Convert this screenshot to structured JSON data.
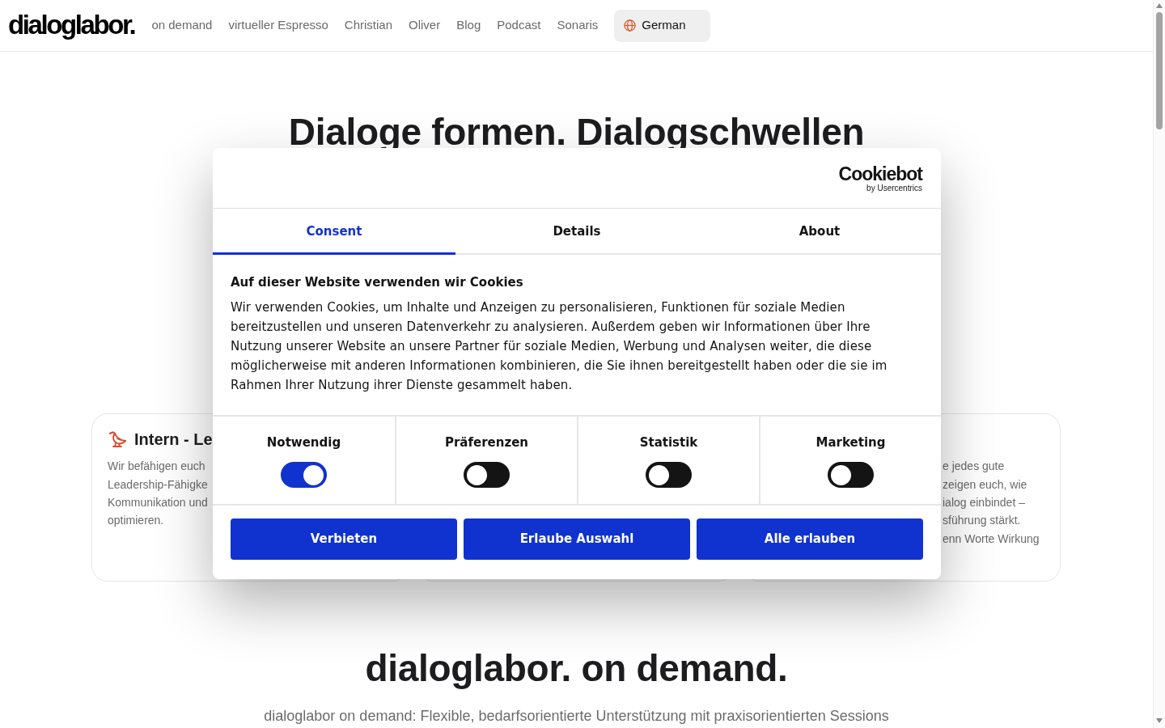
{
  "header": {
    "logo": "dialoglabor.",
    "nav": [
      "on demand",
      "virtueller Espresso",
      "Christian",
      "Oliver",
      "Blog",
      "Podcast",
      "Sonaris"
    ],
    "language": "German"
  },
  "hero": {
    "title": "Dialoge formen. Dialogschwellen"
  },
  "cards": {
    "left": {
      "title": "Intern - Le",
      "body_lines": [
        "Wir befähigen euch",
        "Leadership-Fähigke",
        "Kommunikation und",
        "optimieren."
      ]
    },
    "right": {
      "body_lines": [
        "e jedes gute",
        "zeigen euch, wie",
        "ialog einbindet –",
        "sführung stärkt.",
        "enn Worte Wirkung"
      ]
    }
  },
  "on_demand": {
    "title": "dialoglabor. on demand.",
    "intro": "dialoglabor on demand: Flexible, bedarfsorientierte Unterstützung mit praxisorientierten Sessions"
  },
  "cookie_dialog": {
    "brand": "Cookiebot",
    "brand_tagline": "by Usercentrics",
    "tabs": [
      {
        "label": "Consent",
        "selected": true
      },
      {
        "label": "Details",
        "selected": false
      },
      {
        "label": "About",
        "selected": false
      }
    ],
    "heading": "Auf dieser Website verwenden wir Cookies",
    "text": "Wir verwenden Cookies, um Inhalte und Anzeigen zu personalisieren, Funktionen für soziale Medien bereitzustellen und unseren Datenverkehr zu analysieren. Außerdem geben wir Informationen über Ihre Nutzung unserer Website an unsere Partner für soziale Medien, Werbung und Analysen weiter, die diese möglicherweise mit anderen Informationen kombinieren, die Sie ihnen bereitgestellt haben oder die sie im Rahmen Ihrer Nutzung ihrer Dienste gesammelt haben.",
    "categories": [
      {
        "label": "Notwendig",
        "on": true
      },
      {
        "label": "Präferenzen",
        "on": false
      },
      {
        "label": "Statistik",
        "on": false
      },
      {
        "label": "Marketing",
        "on": false
      }
    ],
    "buttons": [
      "Verbieten",
      "Erlaube Auswahl",
      "Alle erlauben"
    ]
  }
}
